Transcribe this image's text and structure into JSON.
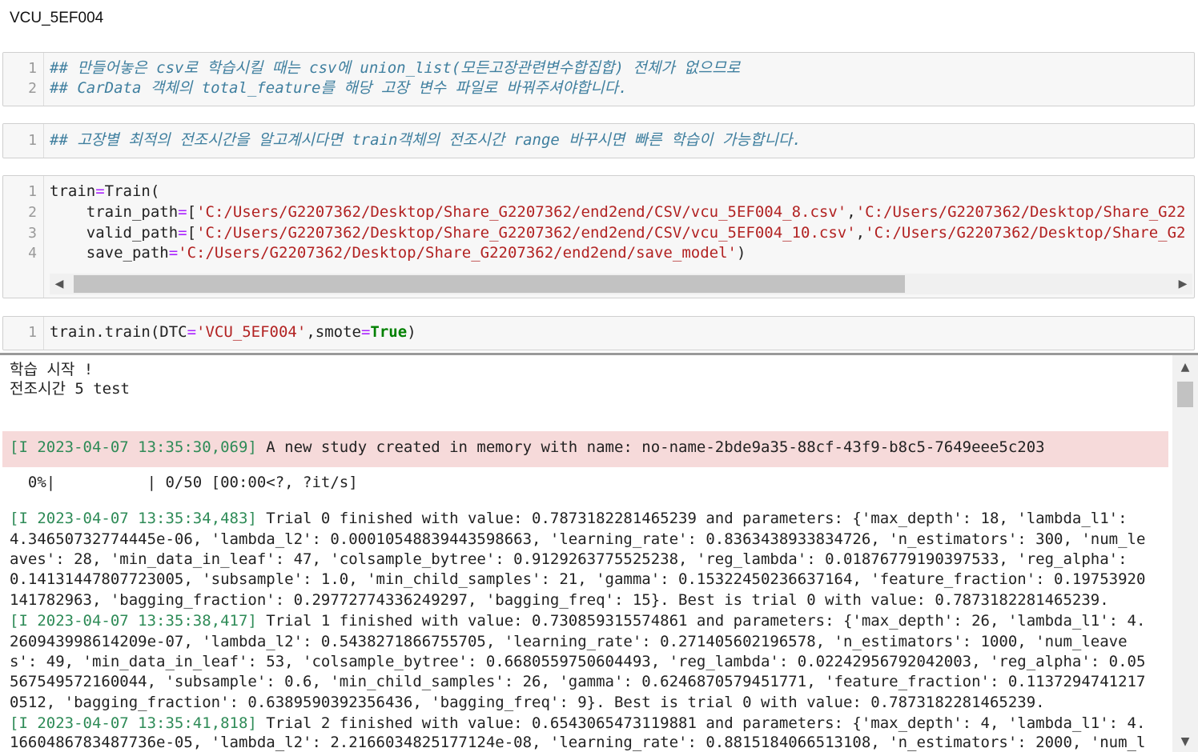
{
  "heading": "VCU_5EF004",
  "cell1": {
    "lines": [
      {
        "num": "1",
        "text": "## 만들어놓은 csv로 학습시킬 때는 csv에 union_list(모든고장관련변수합집합) 전체가 없으므로"
      },
      {
        "num": "2",
        "text": "## CarData 객체의 total_feature를 해당 고장 변수 파일로 바꿔주셔야합니다."
      }
    ]
  },
  "cell2": {
    "lines": [
      {
        "num": "1",
        "text": "## 고장별 최적의 전조시간을 알고계시다면 train객체의 전조시간 range 바꾸시면 빠른 학습이 가능합니다."
      }
    ]
  },
  "cell3": {
    "nums": [
      "1",
      "2",
      "3",
      "4"
    ],
    "l1_a": "train",
    "l1_eq": "=",
    "l1_b": "Train(",
    "l2_a": "    train_path",
    "l2_eq": "=",
    "l2_b": "[",
    "l2_s1": "'C:/Users/G2207362/Desktop/Share_G2207362/end2end/CSV/vcu_5EF004_8.csv'",
    "l2_c": ",",
    "l2_s2": "'C:/Users/G2207362/Desktop/Share_G22",
    "l3_a": "    valid_path",
    "l3_eq": "=",
    "l3_b": "[",
    "l3_s1": "'C:/Users/G2207362/Desktop/Share_G2207362/end2end/CSV/vcu_5EF004_10.csv'",
    "l3_c": ",",
    "l3_s2": "'C:/Users/G2207362/Desktop/Share_G2",
    "l4_a": "    save_path",
    "l4_eq": "=",
    "l4_s1": "'C:/Users/G2207362/Desktop/Share_G2207362/end2end/save_model'",
    "l4_c": ")",
    "scroll_left": "◀",
    "scroll_right": "▶"
  },
  "cell4": {
    "num": "1",
    "a": "train.train(DTC",
    "eq1": "=",
    "s1": "'VCU_5EF004'",
    "b": ",smote",
    "eq2": "=",
    "kw": "True",
    "c": ")"
  },
  "output": {
    "line1": "학습 시작 !",
    "line2": "전조시간 5 test",
    "err_prefix": "[I 2023-04-07 13:35:30,069]",
    "err_text": " A new study created in memory with name: no-name-2bde9a35-88cf-43f9-b8c5-7649eee5c203",
    "progress": "  0%|          | 0/50 [00:00<?, ?it/s]",
    "trials": [
      {
        "prefix": "[I 2023-04-07 13:35:34,483]",
        "first": " Trial 0 finished with value: 0.7873182281465239 and parameters: {'max_depth': 18, 'lambda_l1':",
        "rest": [
          "4.34650732774445e-06, 'lambda_l2': 0.00010548839443598663, 'learning_rate': 0.8363438933834726, 'n_estimators': 300, 'num_le",
          "aves': 28, 'min_data_in_leaf': 47, 'colsample_bytree': 0.9129263775525238, 'reg_lambda': 0.01876779190397533, 'reg_alpha':",
          "0.14131447807723005, 'subsample': 1.0, 'min_child_samples': 21, 'gamma': 0.15322450236637164, 'feature_fraction': 0.19753920",
          "141782963, 'bagging_fraction': 0.29772774336249297, 'bagging_freq': 15}. Best is trial 0 with value: 0.7873182281465239."
        ]
      },
      {
        "prefix": "[I 2023-04-07 13:35:38,417]",
        "first": " Trial 1 finished with value: 0.730859315574861 and parameters: {'max_depth': 26, 'lambda_l1': 4.",
        "rest": [
          "260943998614209e-07, 'lambda_l2': 0.5438271866755705, 'learning_rate': 0.271405602196578, 'n_estimators': 1000, 'num_leave",
          "s': 49, 'min_data_in_leaf': 53, 'colsample_bytree': 0.6680559750604493, 'reg_lambda': 0.02242956792042003, 'reg_alpha': 0.05",
          "567549572160044, 'subsample': 0.6, 'min_child_samples': 26, 'gamma': 0.6246870579451771, 'feature_fraction': 0.1137294741217",
          "0512, 'bagging_fraction': 0.6389590392356436, 'bagging_freq': 9}. Best is trial 0 with value: 0.7873182281465239."
        ]
      },
      {
        "prefix": "[I 2023-04-07 13:35:41,818]",
        "first": " Trial 2 finished with value: 0.6543065473119881 and parameters: {'max_depth': 4, 'lambda_l1': 4.",
        "rest": [
          "1660486783487736e-05, 'lambda_l2': 2.2166034825177124e-08, 'learning_rate': 0.8815184066513108, 'n_estimators': 2000, 'num_l"
        ]
      }
    ],
    "scroll_up": "▲",
    "scroll_down": "▼"
  }
}
